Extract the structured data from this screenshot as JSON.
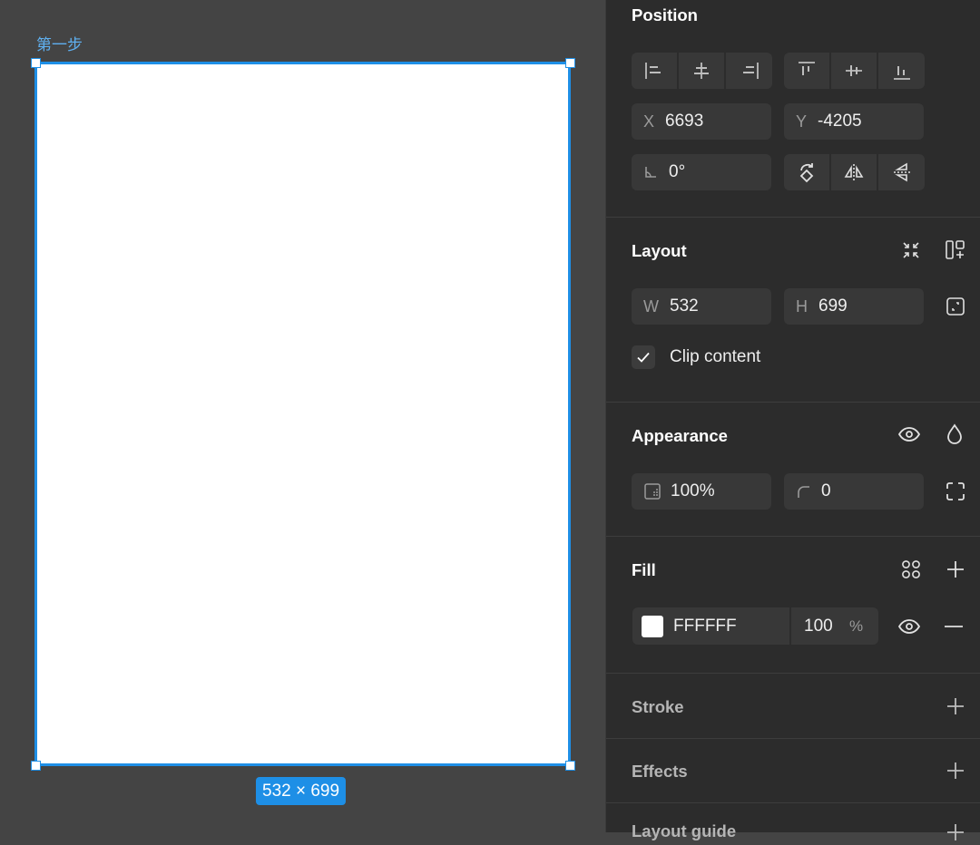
{
  "canvas": {
    "frame_label": "第一步",
    "frame_size_badge": "532 × 699"
  },
  "position": {
    "title": "Position",
    "x_prefix": "X",
    "x_value": "6693",
    "y_prefix": "Y",
    "y_value": "-4205",
    "rotation_value": "0°"
  },
  "layout": {
    "title": "Layout",
    "w_prefix": "W",
    "w_value": "532",
    "h_prefix": "H",
    "h_value": "699",
    "clip_content_label": "Clip content",
    "clip_content_checked": true
  },
  "appearance": {
    "title": "Appearance",
    "opacity_value": "100%",
    "corner_radius_value": "0"
  },
  "fill": {
    "title": "Fill",
    "hex_value": "FFFFFF",
    "swatch_color": "#FFFFFF",
    "opacity_value": "100",
    "opacity_unit": "%"
  },
  "stroke": {
    "title": "Stroke"
  },
  "effects": {
    "title": "Effects"
  },
  "next_section": {
    "title": "Layout guide"
  },
  "colors": {
    "selection_accent": "#1E8FE6",
    "panel_bg": "#2C2C2C",
    "canvas_bg": "#444444",
    "field_bg": "#383838"
  }
}
